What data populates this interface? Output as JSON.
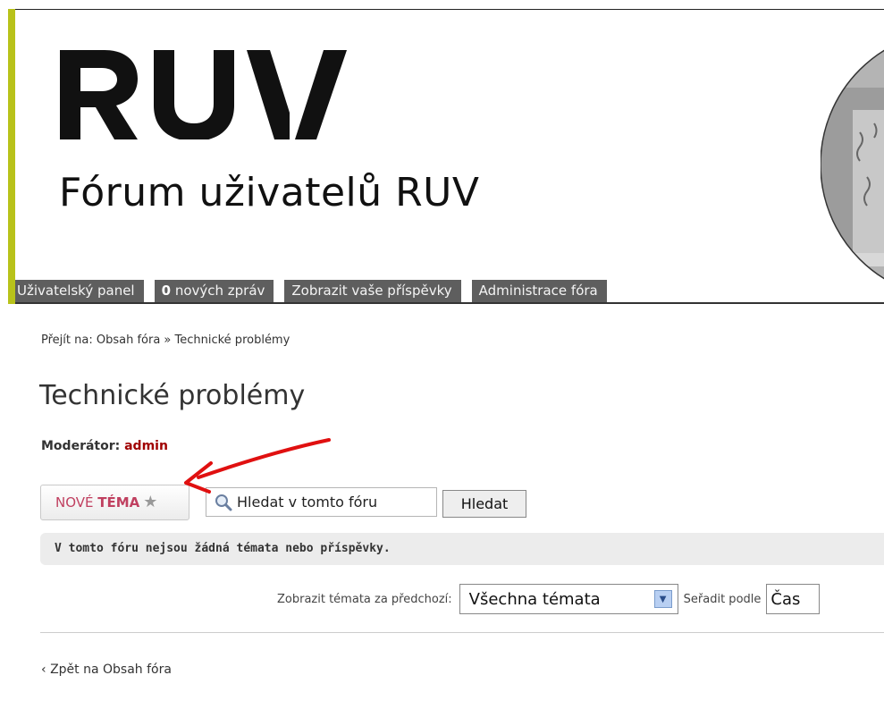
{
  "header": {
    "logo_text": "RUV",
    "forum_title": "Fórum uživatelů RUV"
  },
  "navbar": {
    "items": [
      {
        "label": "Uživatelský panel"
      },
      {
        "count": "0",
        "label": " nových zpráv"
      },
      {
        "label": "Zobrazit vaše příspěvky"
      },
      {
        "label": "Administrace fóra"
      }
    ]
  },
  "breadcrumb": {
    "prefix": "Přejít na: ",
    "home": "Obsah fóra",
    "separator": " » ",
    "current": "Technické problémy"
  },
  "page": {
    "title": "Technické problémy",
    "moderator_label": "Moderátor: ",
    "moderator_name": "admin"
  },
  "actions": {
    "new_topic_part1": "NOVÉ ",
    "new_topic_part2": "TÉMA",
    "new_topic_star": "★",
    "search_placeholder": "Hledat v tomto fóru",
    "search_button": "Hledat"
  },
  "notice": "V tomto fóru nejsou žádná témata nebo příspěvky.",
  "filters": {
    "display_label": "Zobrazit témata za předchozí:",
    "display_value": "Všechna témata",
    "sort_label": "Seřadit podle",
    "sort_value": "Čas"
  },
  "footer": {
    "back_arrow": "‹",
    "back_link": "Zpět na Obsah fóra"
  },
  "colors": {
    "accent": "#b8c21a",
    "nav_bg": "#5e5e5e",
    "moderator_link": "#a00000",
    "new_topic_text": "#c04060",
    "annotation_arrow": "#e01010"
  }
}
